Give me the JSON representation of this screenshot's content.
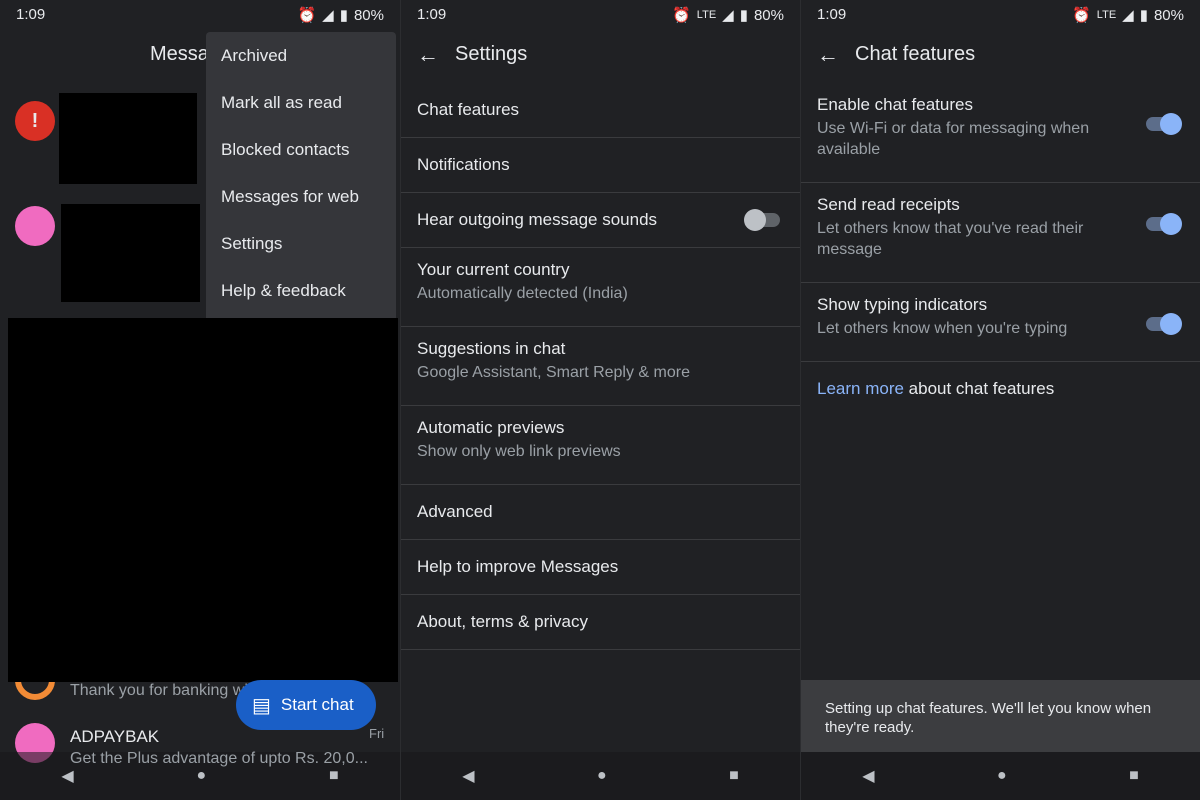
{
  "status": {
    "time": "1:09",
    "network": "LTE",
    "battery": "80%"
  },
  "messages_panel": {
    "title": "Messages",
    "menu": [
      "Archived",
      "Mark all as read",
      "Blocked contacts",
      "Messages for web",
      "Settings",
      "Help & feedback"
    ],
    "conversations": [
      {
        "preview": "Thank you for banking wi",
        "avatar_color": "#f28b36"
      },
      {
        "name": "ADPAYBAK",
        "preview": "Get the Plus advantage of upto Rs. 20,0...",
        "time": "Fri",
        "avatar_color": "#f06bc0"
      }
    ],
    "fab_label": "Start chat"
  },
  "settings_panel": {
    "title": "Settings",
    "items": [
      {
        "title": "Chat features"
      },
      {
        "title": "Notifications"
      },
      {
        "title": "Hear outgoing message sounds",
        "toggle": false
      },
      {
        "title": "Your current country",
        "subtitle": "Automatically detected (India)"
      },
      {
        "title": "Suggestions in chat",
        "subtitle": "Google Assistant, Smart Reply & more"
      },
      {
        "title": "Automatic previews",
        "subtitle": "Show only web link previews"
      },
      {
        "title": "Advanced"
      },
      {
        "title": "Help to improve Messages"
      },
      {
        "title": "About, terms & privacy"
      }
    ]
  },
  "chat_panel": {
    "title": "Chat features",
    "items": [
      {
        "title": "Enable chat features",
        "subtitle": "Use Wi-Fi or data for messaging when available",
        "toggle": true
      },
      {
        "title": "Send read receipts",
        "subtitle": "Let others know that you've read their message",
        "toggle": true
      },
      {
        "title": "Show typing indicators",
        "subtitle": "Let others know when you're typing",
        "toggle": true
      }
    ],
    "learn_more_link": "Learn more",
    "learn_more_rest": " about chat features",
    "snackbar": "Setting up chat features. We'll let you know when they're ready."
  },
  "colors": {
    "accent": "#8ab4f8",
    "fab": "#1a5fc7",
    "background": "#202124",
    "error": "#d93025"
  }
}
